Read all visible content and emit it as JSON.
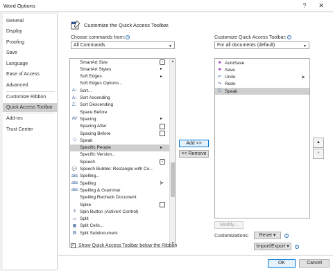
{
  "window": {
    "title": "Word Options",
    "help_glyph": "?",
    "close_glyph": "✕"
  },
  "nav": {
    "items": [
      "General",
      "Display",
      "Proofing",
      "Save",
      "Language",
      "Ease of Access",
      "Advanced",
      "Customize Ribbon",
      "Quick Access Toolbar",
      "Add-ins",
      "Trust Center"
    ],
    "selected": "Quick Access Toolbar"
  },
  "header": {
    "title": "Customize the Quick Access Toolbar."
  },
  "choose": {
    "label": "Choose commands from:",
    "selected": "All Commands",
    "items": [
      {
        "label": "SmartArt Size",
        "icon": "",
        "indicator": "combo"
      },
      {
        "label": "SmartArt Styles",
        "icon": "",
        "indicator": "arrow"
      },
      {
        "label": "Soft Edges",
        "icon": "",
        "indicator": "arrow"
      },
      {
        "label": "Soft Edges Options...",
        "icon": "",
        "indicator": ""
      },
      {
        "label": "Sort...",
        "icon": "A↕",
        "indicator": ""
      },
      {
        "label": "Sort Ascending",
        "icon": "A↓",
        "indicator": ""
      },
      {
        "label": "Sort Descending",
        "icon": "Z↓",
        "indicator": ""
      },
      {
        "label": "Space Before",
        "icon": "",
        "indicator": ""
      },
      {
        "label": "Spacing",
        "icon": "AV",
        "indicator": "arrow"
      },
      {
        "label": "Spacing After",
        "icon": "",
        "indicator": "box"
      },
      {
        "label": "Spacing Before",
        "icon": "",
        "indicator": "box"
      },
      {
        "label": "Speak",
        "icon": "🗨",
        "indicator": ""
      },
      {
        "label": "Specific People",
        "icon": "",
        "indicator": "arrow"
      },
      {
        "label": "Specific Version...",
        "icon": "",
        "indicator": ""
      },
      {
        "label": "Speech",
        "icon": "",
        "indicator": "combo"
      },
      {
        "label": "Speech Bubble: Rectangle with Co...",
        "icon": "💬",
        "indicator": ""
      },
      {
        "label": "Spelling...",
        "icon": "abc",
        "indicator": ""
      },
      {
        "label": "Spelling",
        "icon": "abc",
        "indicator": "split"
      },
      {
        "label": "Spelling & Grammar",
        "icon": "abc",
        "indicator": ""
      },
      {
        "label": "Spelling Recheck Document",
        "icon": "",
        "indicator": ""
      },
      {
        "label": "Spike",
        "icon": "",
        "indicator": "box"
      },
      {
        "label": "Spin Button (ActiveX Control)",
        "icon": "⇕",
        "indicator": ""
      },
      {
        "label": "Split",
        "icon": "▭",
        "indicator": ""
      },
      {
        "label": "Split Cells...",
        "icon": "▦",
        "indicator": ""
      },
      {
        "label": "Split Subdocument",
        "icon": "▤",
        "indicator": ""
      }
    ],
    "selected_item": "Specific People"
  },
  "customize": {
    "label": "Customize Quick Access Toolbar:",
    "selected": "For all documents (default)",
    "items": [
      {
        "label": "AutoSave",
        "icon": "■",
        "indicator": ""
      },
      {
        "label": "Save",
        "icon": "■",
        "indicator": ""
      },
      {
        "label": "Undo",
        "icon": "↶",
        "indicator": "split"
      },
      {
        "label": "Redo",
        "icon": "↷",
        "indicator": ""
      },
      {
        "label": "Speak",
        "icon": "🗨",
        "indicator": ""
      }
    ],
    "selected_item": "Speak"
  },
  "buttons": {
    "add": "Add >>",
    "remove": "<< Remove",
    "move_up": "▲",
    "move_down": "▼",
    "modify": "Modify...",
    "reset": "Reset ▾",
    "import_export": "Import/Export ▾",
    "ok": "OK",
    "cancel": "Cancel"
  },
  "customizations_label": "Customizations:",
  "show_below_ribbon": {
    "label": "Show Quick Access Toolbar below the Ribbon",
    "checked": true
  },
  "colors": {
    "accent": "#0078d7",
    "selection": "#cfcfcf"
  }
}
